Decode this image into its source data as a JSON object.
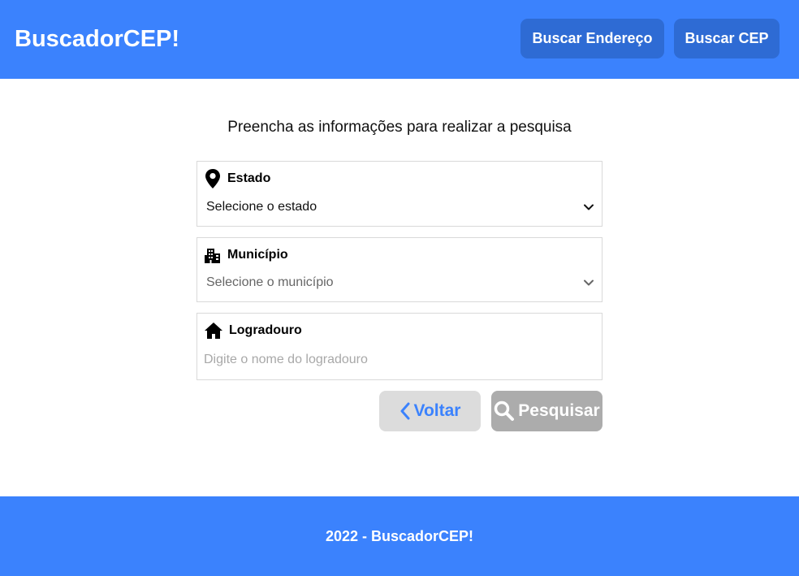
{
  "header": {
    "brand": "BuscadorCEP!",
    "nav": [
      {
        "label": "Buscar Endereço"
      },
      {
        "label": "Buscar CEP"
      }
    ]
  },
  "main": {
    "subtitle": "Preencha as informações para realizar a pesquisa",
    "fields": {
      "estado": {
        "label": "Estado",
        "value": "Selecione o estado",
        "icon": "map-pin-icon"
      },
      "municipio": {
        "label": "Município",
        "value": "Selecione o município",
        "icon": "city-buildings-icon"
      },
      "logradouro": {
        "label": "Logradouro",
        "value": "",
        "placeholder": "Digite o nome do logradouro",
        "icon": "house-icon"
      }
    },
    "buttons": {
      "back": {
        "label": "Voltar",
        "icon": "chevron-left-icon"
      },
      "search": {
        "label": "Pesquisar",
        "icon": "search-icon"
      }
    }
  },
  "footer": {
    "text": "2022 - BuscadorCEP!"
  },
  "colors": {
    "primary": "#3b82fd",
    "nav_button": "#2e6bd4",
    "back_button_bg": "#dcdcdc",
    "search_button_bg": "#acacac"
  }
}
